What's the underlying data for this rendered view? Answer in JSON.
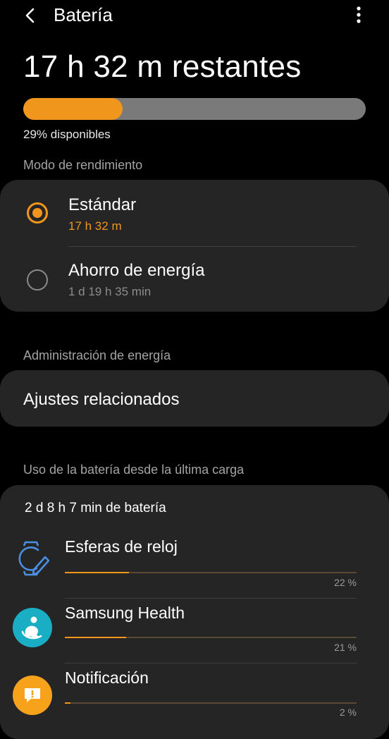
{
  "header": {
    "title": "Batería",
    "back_icon": "chevron-left-icon",
    "more_icon": "more-vertical-icon"
  },
  "battery": {
    "remaining": "17 h 32 m restantes",
    "level_fraction": 0.29,
    "available_text": "29% disponibles",
    "fill_color": "#f0961c",
    "track_color": "#7a7a7a"
  },
  "performance": {
    "section_label": "Modo de rendimiento",
    "options": [
      {
        "label": "Estándar",
        "time": "17 h 32 m",
        "selected": true
      },
      {
        "label": "Ahorro de energía",
        "time": "1 d 19 h 35 min",
        "selected": false
      }
    ]
  },
  "power_management": {
    "section_label": "Administración de energía",
    "related_settings": "Ajustes relacionados"
  },
  "usage": {
    "section_label": "Uso de la batería desde la última carga",
    "total": "2 d 8 h 7 min de batería",
    "apps": [
      {
        "name": "Esferas de reloj",
        "percent_text": "22 %",
        "fraction": 0.22,
        "icon": "watch-face-edit-icon"
      },
      {
        "name": "Samsung Health",
        "percent_text": "21 %",
        "fraction": 0.21,
        "icon": "samsung-health-icon"
      },
      {
        "name": "Notificación",
        "percent_text": "2 %",
        "fraction": 0.02,
        "icon": "notification-icon"
      }
    ]
  },
  "colors": {
    "accent": "#f0961c",
    "background": "#000000",
    "card": "#252525",
    "health_teal": "#1aaec5",
    "notification_orange": "#f7a21b"
  }
}
